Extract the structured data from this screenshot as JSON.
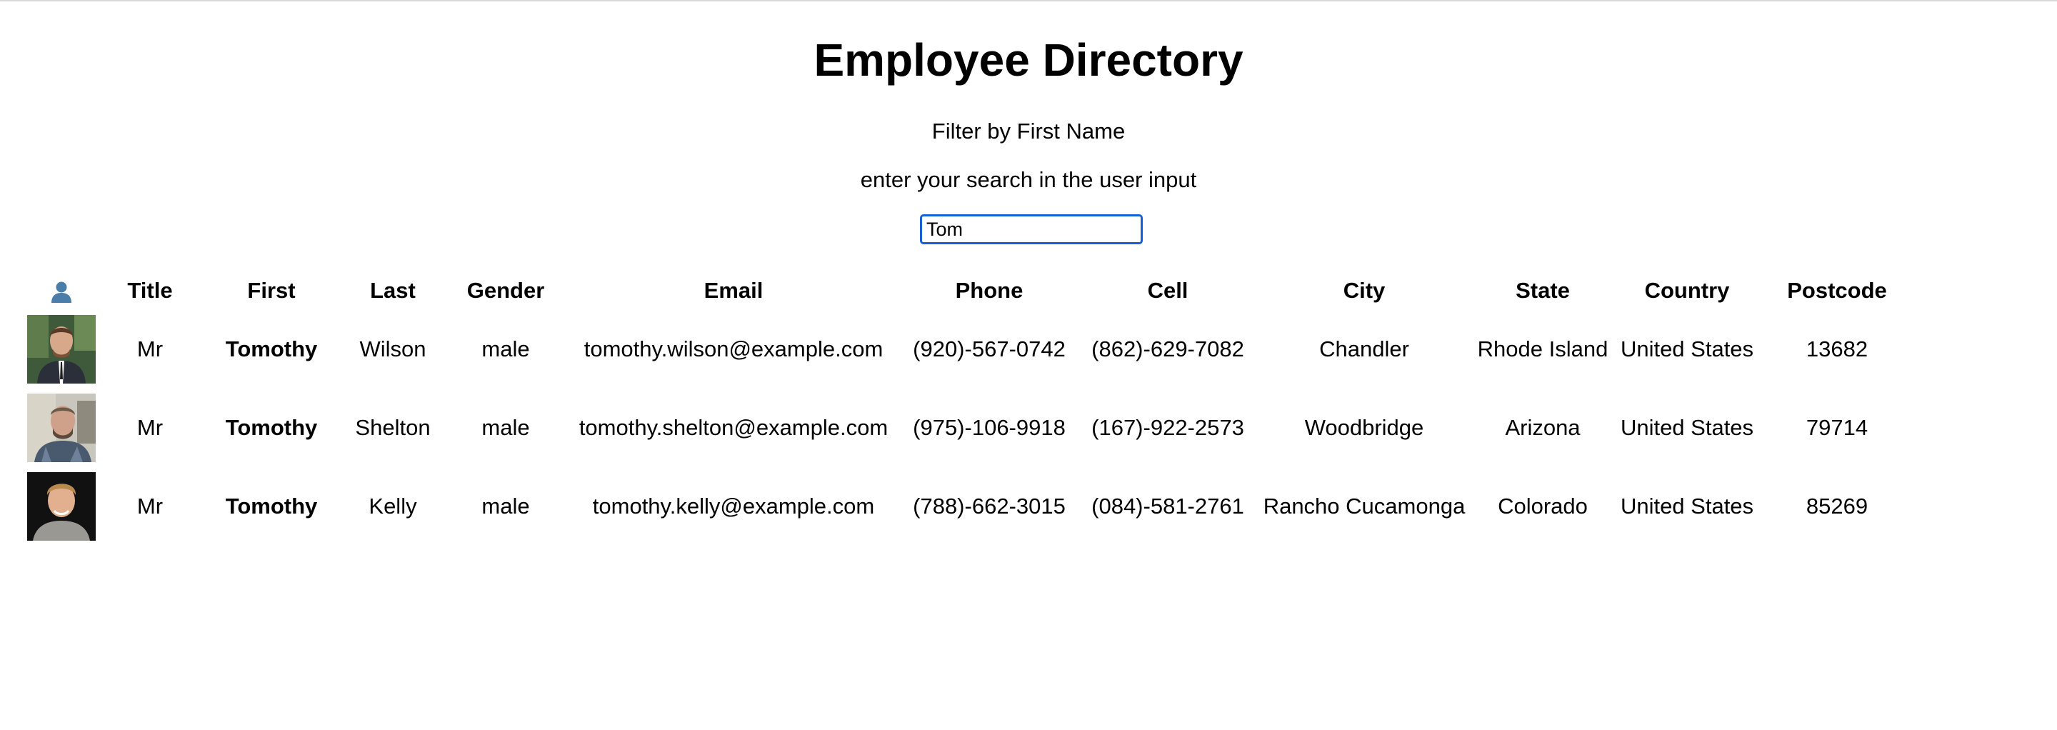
{
  "header": {
    "title": "Employee Directory",
    "filter_label": "Filter by First Name",
    "filter_hint": "enter your search in the user input"
  },
  "search": {
    "value": "Tom",
    "placeholder": ""
  },
  "table": {
    "photo_header_icon": "user-silhouette-icon",
    "columns": [
      "Title",
      "First",
      "Last",
      "Gender",
      "Email",
      "Phone",
      "Cell",
      "City",
      "State",
      "Country",
      "Postcode"
    ],
    "rows": [
      {
        "photo": "employee-photo",
        "title": "Mr",
        "first": "Tomothy",
        "last": "Wilson",
        "gender": "male",
        "email": "tomothy.wilson@example.com",
        "phone": "(920)-567-0742",
        "cell": "(862)-629-7082",
        "city": "Chandler",
        "state": "Rhode Island",
        "country": "United States",
        "postcode": "13682"
      },
      {
        "photo": "employee-photo",
        "title": "Mr",
        "first": "Tomothy",
        "last": "Shelton",
        "gender": "male",
        "email": "tomothy.shelton@example.com",
        "phone": "(975)-106-9918",
        "cell": "(167)-922-2573",
        "city": "Woodbridge",
        "state": "Arizona",
        "country": "United States",
        "postcode": "79714"
      },
      {
        "photo": "employee-photo",
        "title": "Mr",
        "first": "Tomothy",
        "last": "Kelly",
        "gender": "male",
        "email": "tomothy.kelly@example.com",
        "phone": "(788)-662-3015",
        "cell": "(084)-581-2761",
        "city": "Rancho Cucamonga",
        "state": "Colorado",
        "country": "United States",
        "postcode": "85269"
      }
    ]
  },
  "colors": {
    "input_focus_border": "#1660d6",
    "header_icon": "#4a7da8"
  }
}
